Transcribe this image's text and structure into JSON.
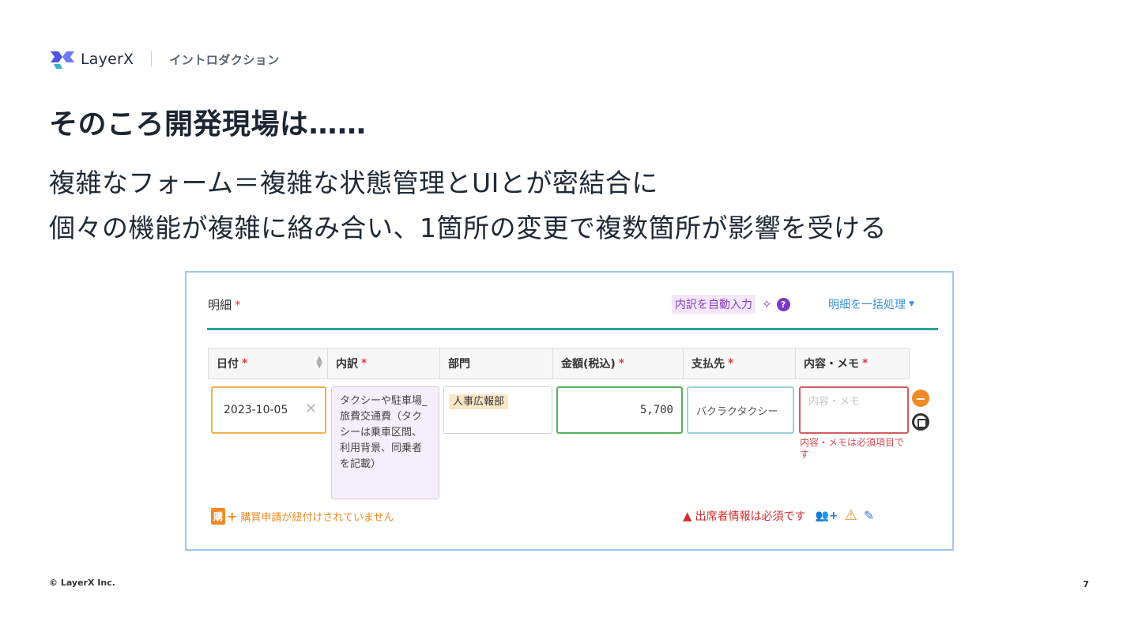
{
  "header": {
    "logo_text": "LayerX",
    "section": "イントロダクション"
  },
  "title": "そのころ開発現場は……",
  "subtitle": [
    "複雑なフォーム＝複雑な状態管理とUIとが密結合に",
    "個々の機能が複雑に絡み合い、1箇所の変更で複数箇所が影響を受ける"
  ],
  "screenshot": {
    "section_title": "明細",
    "required_mark": "*",
    "auto_input_label": "内訳を自動入力",
    "help_glyph": "?",
    "bulk_label": "明細を一括処理",
    "columns": [
      "日付",
      "内訳",
      "部門",
      "金額(税込)",
      "支払先",
      "内容・メモ"
    ],
    "row": {
      "date": "2023-10-05",
      "breakdown": "タクシーや駐車場_旅費交通費（タクシーは乗車区間、利用背景、同乗者を記載）",
      "department": "人事広報部",
      "amount": "5,700",
      "payee": "バクラクタクシー",
      "memo_placeholder": "内容・メモ",
      "memo_error": "内容・メモは必須項目です"
    },
    "purchase_icon": "購",
    "purchase_text": "購買申請が紐付けされていません",
    "attendee_text": "出席者情報は必須です"
  },
  "footer": "© LayerX Inc.",
  "page_number": "7",
  "colors": {
    "accent_teal": "#27a69a",
    "error": "#d32f2f",
    "warning": "#f08a24",
    "link": "#3a8fdb"
  }
}
